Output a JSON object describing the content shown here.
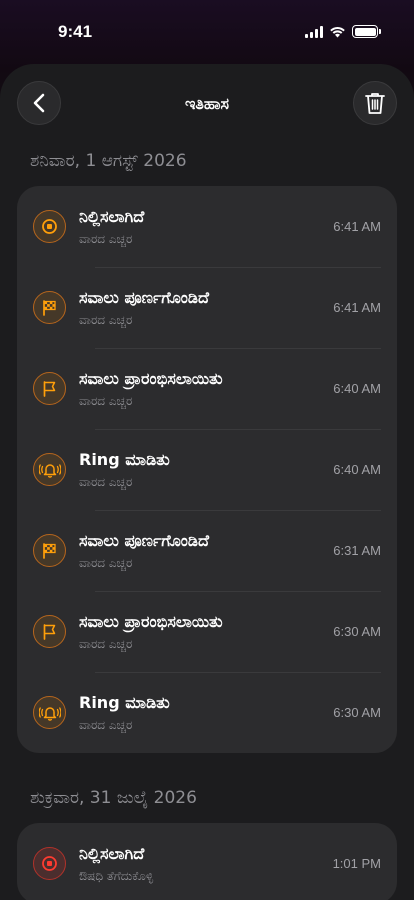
{
  "status_bar": {
    "time": "9:41"
  },
  "nav": {
    "title": "ಇತಿಹಾಸ"
  },
  "colors": {
    "accent": "#ff9f0a",
    "alert": "#ff3b30",
    "background": "#1c1c1e",
    "card": "#2c2c2e"
  },
  "sections": [
    {
      "header": "ಶನಿವಾರ, 1 ಆಗಸ್ಟ್ 2026",
      "items": [
        {
          "icon": "stop-icon",
          "title": "ನಿಲ್ಲಿಸಲಾಗಿದೆ",
          "subtitle": "ವಾರದ ಎಚ್ಚರ",
          "time": "6:41 AM"
        },
        {
          "icon": "checkered-flag-icon",
          "title": "ಸವಾಲು ಪೂರ್ಣಗೊಂಡಿದೆ",
          "subtitle": "ವಾರದ ಎಚ್ಚರ",
          "time": "6:41 AM"
        },
        {
          "icon": "flag-icon",
          "title": "ಸವಾಲು ಪ್ರಾರಂಭಿಸಲಾಯಿತು",
          "subtitle": "ವಾರದ ಎಚ್ಚರ",
          "time": "6:40 AM"
        },
        {
          "icon": "ringing-bell-icon",
          "title": "Ring ಮಾಡಿತು",
          "subtitle": "ವಾರದ ಎಚ್ಚರ",
          "time": "6:40 AM"
        },
        {
          "icon": "checkered-flag-icon",
          "title": "ಸವಾಲು ಪೂರ್ಣಗೊಂಡಿದೆ",
          "subtitle": "ವಾರದ ಎಚ್ಚರ",
          "time": "6:31 AM"
        },
        {
          "icon": "flag-icon",
          "title": "ಸವಾಲು ಪ್ರಾರಂಭಿಸಲಾಯಿತು",
          "subtitle": "ವಾರದ ಎಚ್ಚರ",
          "time": "6:30 AM"
        },
        {
          "icon": "ringing-bell-icon",
          "title": "Ring ಮಾಡಿತು",
          "subtitle": "ವಾರದ ಎಚ್ಚರ",
          "time": "6:30 AM"
        }
      ]
    },
    {
      "header": "ಶುಕ್ರವಾರ, 31 ಜುಲೈ 2026",
      "items": [
        {
          "icon": "stop-icon",
          "title": "ನಿಲ್ಲಿಸಲಾಗಿದೆ",
          "subtitle": "ಔಷಧಿ ತೆಗೆದುಕೊಳ್ಳಿ",
          "time": "1:01 PM"
        }
      ]
    }
  ]
}
